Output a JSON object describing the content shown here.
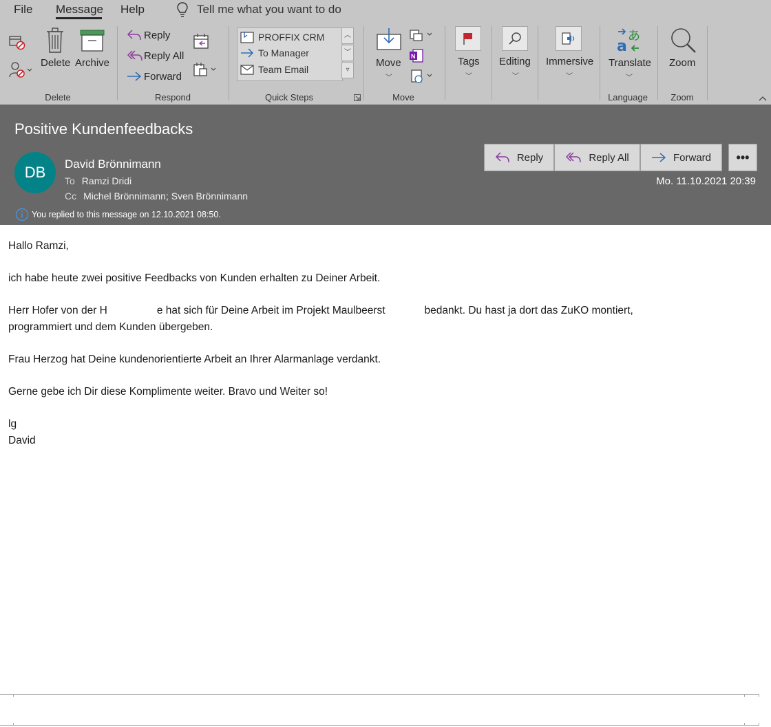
{
  "tabs": {
    "file": "File",
    "message": "Message",
    "help": "Help"
  },
  "tellme": {
    "text": "Tell me what you want to do"
  },
  "ribbon": {
    "delete_group": {
      "delete": "Delete",
      "archive": "Archive",
      "label": "Delete"
    },
    "respond_group": {
      "reply": "Reply",
      "reply_all": "Reply All",
      "forward": "Forward",
      "label": "Respond"
    },
    "quick_steps": {
      "items": [
        "PROFFIX CRM",
        "To Manager",
        "Team Email"
      ],
      "label": "Quick Steps"
    },
    "move_group": {
      "move": "Move",
      "label": "Move"
    },
    "tags": {
      "label": "Tags"
    },
    "editing": {
      "label": "Editing"
    },
    "immersive": {
      "label": "Immersive"
    },
    "language": {
      "translate": "Translate",
      "label": "Language"
    },
    "zoom": {
      "zoom": "Zoom",
      "label": "Zoom"
    }
  },
  "message": {
    "subject": "Positive Kundenfeedbacks",
    "avatar_initials": "DB",
    "sender": "David Brönnimann",
    "to_label": "To",
    "to": "Ramzi Dridi",
    "cc_label": "Cc",
    "cc": "Michel Brönnimann; Sven Brönnimann",
    "info": "You replied to this message on 12.10.2021 08:50.",
    "date": "Mo. 11.10.2021 20:39",
    "actions": {
      "reply": "Reply",
      "reply_all": "Reply All",
      "forward": "Forward",
      "more": "•••"
    }
  },
  "body": {
    "greeting": "Hallo Ramzi,",
    "p1": "ich habe heute zwei positive Feedbacks von Kunden erhalten zu Deiner Arbeit.",
    "p2a": "Herr Hofer von der H",
    "p2b": "e hat sich für Deine Arbeit im Projekt Maulbeerst",
    "p2c": "bedankt. Du hast ja dort das ZuKO montiert,",
    "p2d": "programmiert und dem Kunden übergeben.",
    "p3": "Frau Herzog hat Deine kundenorientierte Arbeit an Ihrer Alarmanlage verdankt.",
    "p4": "Gerne gebe ich Dir diese Komplimente weiter. Bravo und Weiter so!",
    "closing1": "lg",
    "closing2": "David"
  },
  "colors": {
    "ribbon": "#c6c6c6",
    "header": "#686868",
    "avatar": "#038387",
    "reply_purple": "#8b3a9e",
    "forward_blue": "#2e6db4",
    "flag_red": "#c4262e"
  }
}
